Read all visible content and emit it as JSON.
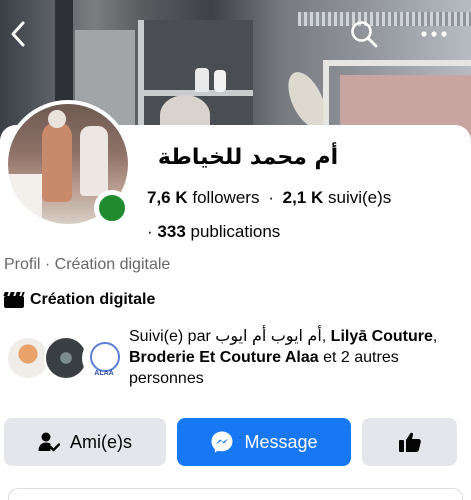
{
  "nav": {
    "back_icon": "chevron-left-icon",
    "search_icon": "search-icon",
    "more_icon": "more-horizontal-icon"
  },
  "profile": {
    "name": "أم محمد للخياطة",
    "followers_count": "7,6 K",
    "followers_label": "followers",
    "following_count": "2,1 K",
    "following_label": "suivi(e)s",
    "posts_count": "333",
    "posts_label": "publications",
    "status": "online",
    "status_color": "#1f8a2e"
  },
  "category": {
    "line": "Profil · Création digitale",
    "icon": "clapperboard-icon",
    "label": "Création digitale"
  },
  "followed_by": {
    "prefix": "Suivi(e) par",
    "name1": "أم ايوب أم ايوب",
    "sep1": ",",
    "name2": "Lilyā Couture",
    "sep2": ",",
    "name3": "Broderie Et Couture Alaa",
    "suffix": "et 2 autres personnes",
    "avatar3_label": "ALAA"
  },
  "actions": {
    "friends_label": "Ami(e)s",
    "message_label": "Message",
    "friends_icon": "person-check-icon",
    "message_icon": "messenger-icon",
    "like_icon": "thumbs-up-icon"
  },
  "colors": {
    "accent": "#1877f2",
    "button_gray": "#e4e6eb",
    "muted_text": "#65676b"
  }
}
